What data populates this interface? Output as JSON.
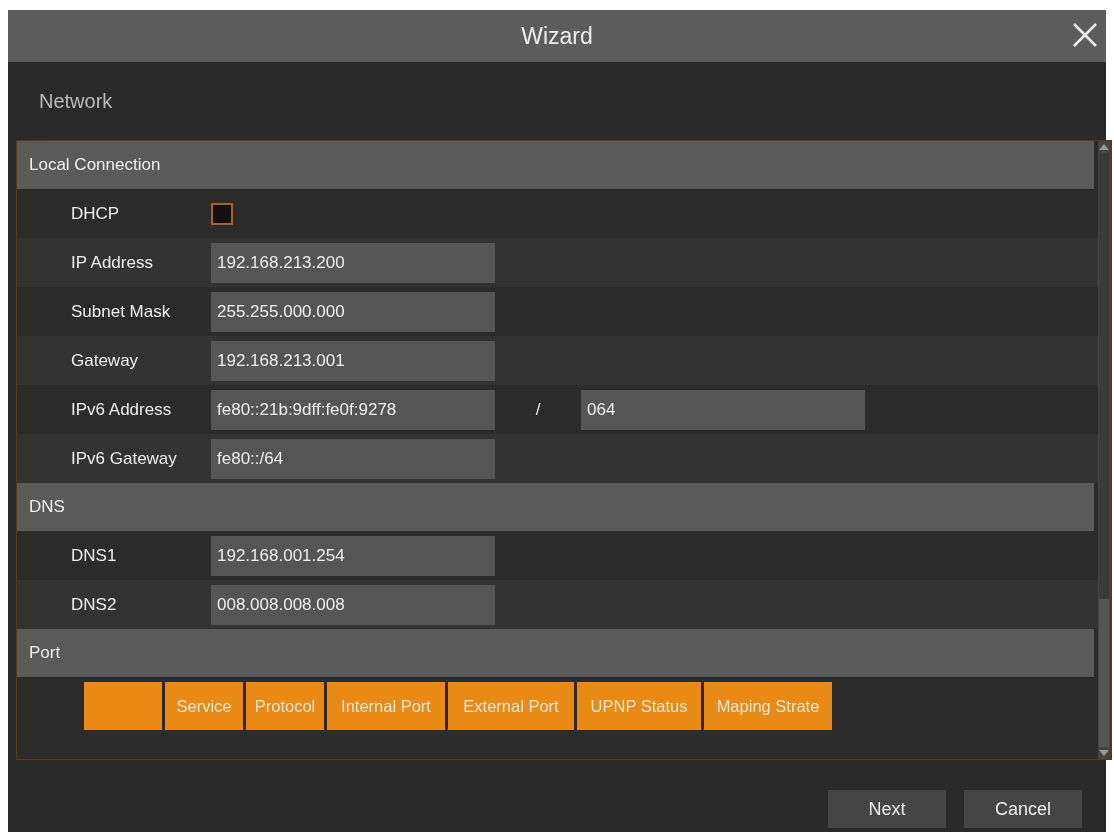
{
  "window": {
    "title": "Wizard"
  },
  "page_title": "Network",
  "sections": [
    {
      "title": "Local Connection",
      "rows": [
        {
          "kind": "checkbox",
          "label": "DHCP",
          "checked": false
        },
        {
          "kind": "field",
          "label": "IP Address",
          "value": "192.168.213.200"
        },
        {
          "kind": "field",
          "label": "Subnet Mask",
          "value": "255.255.000.000"
        },
        {
          "kind": "field",
          "label": "Gateway",
          "value": "192.168.213.001"
        },
        {
          "kind": "prefix",
          "label": "IPv6 Address",
          "value": "fe80::21b:9dff:fe0f:9278",
          "separator": "/",
          "prefix": "064"
        },
        {
          "kind": "field",
          "label": "IPv6 Gateway",
          "value": "fe80::/64"
        }
      ]
    },
    {
      "title": "DNS",
      "rows": [
        {
          "kind": "field",
          "label": "DNS1",
          "value": "192.168.001.254"
        },
        {
          "kind": "field",
          "label": "DNS2",
          "value": "008.008.008.008"
        }
      ]
    },
    {
      "title": "Port",
      "table": {
        "columns": [
          "",
          "Service",
          "Protocol",
          "Internal Port",
          "External Port",
          "UPNP Status",
          "Maping Strate"
        ]
      }
    }
  ],
  "buttons": [
    "Next",
    "Cancel"
  ]
}
